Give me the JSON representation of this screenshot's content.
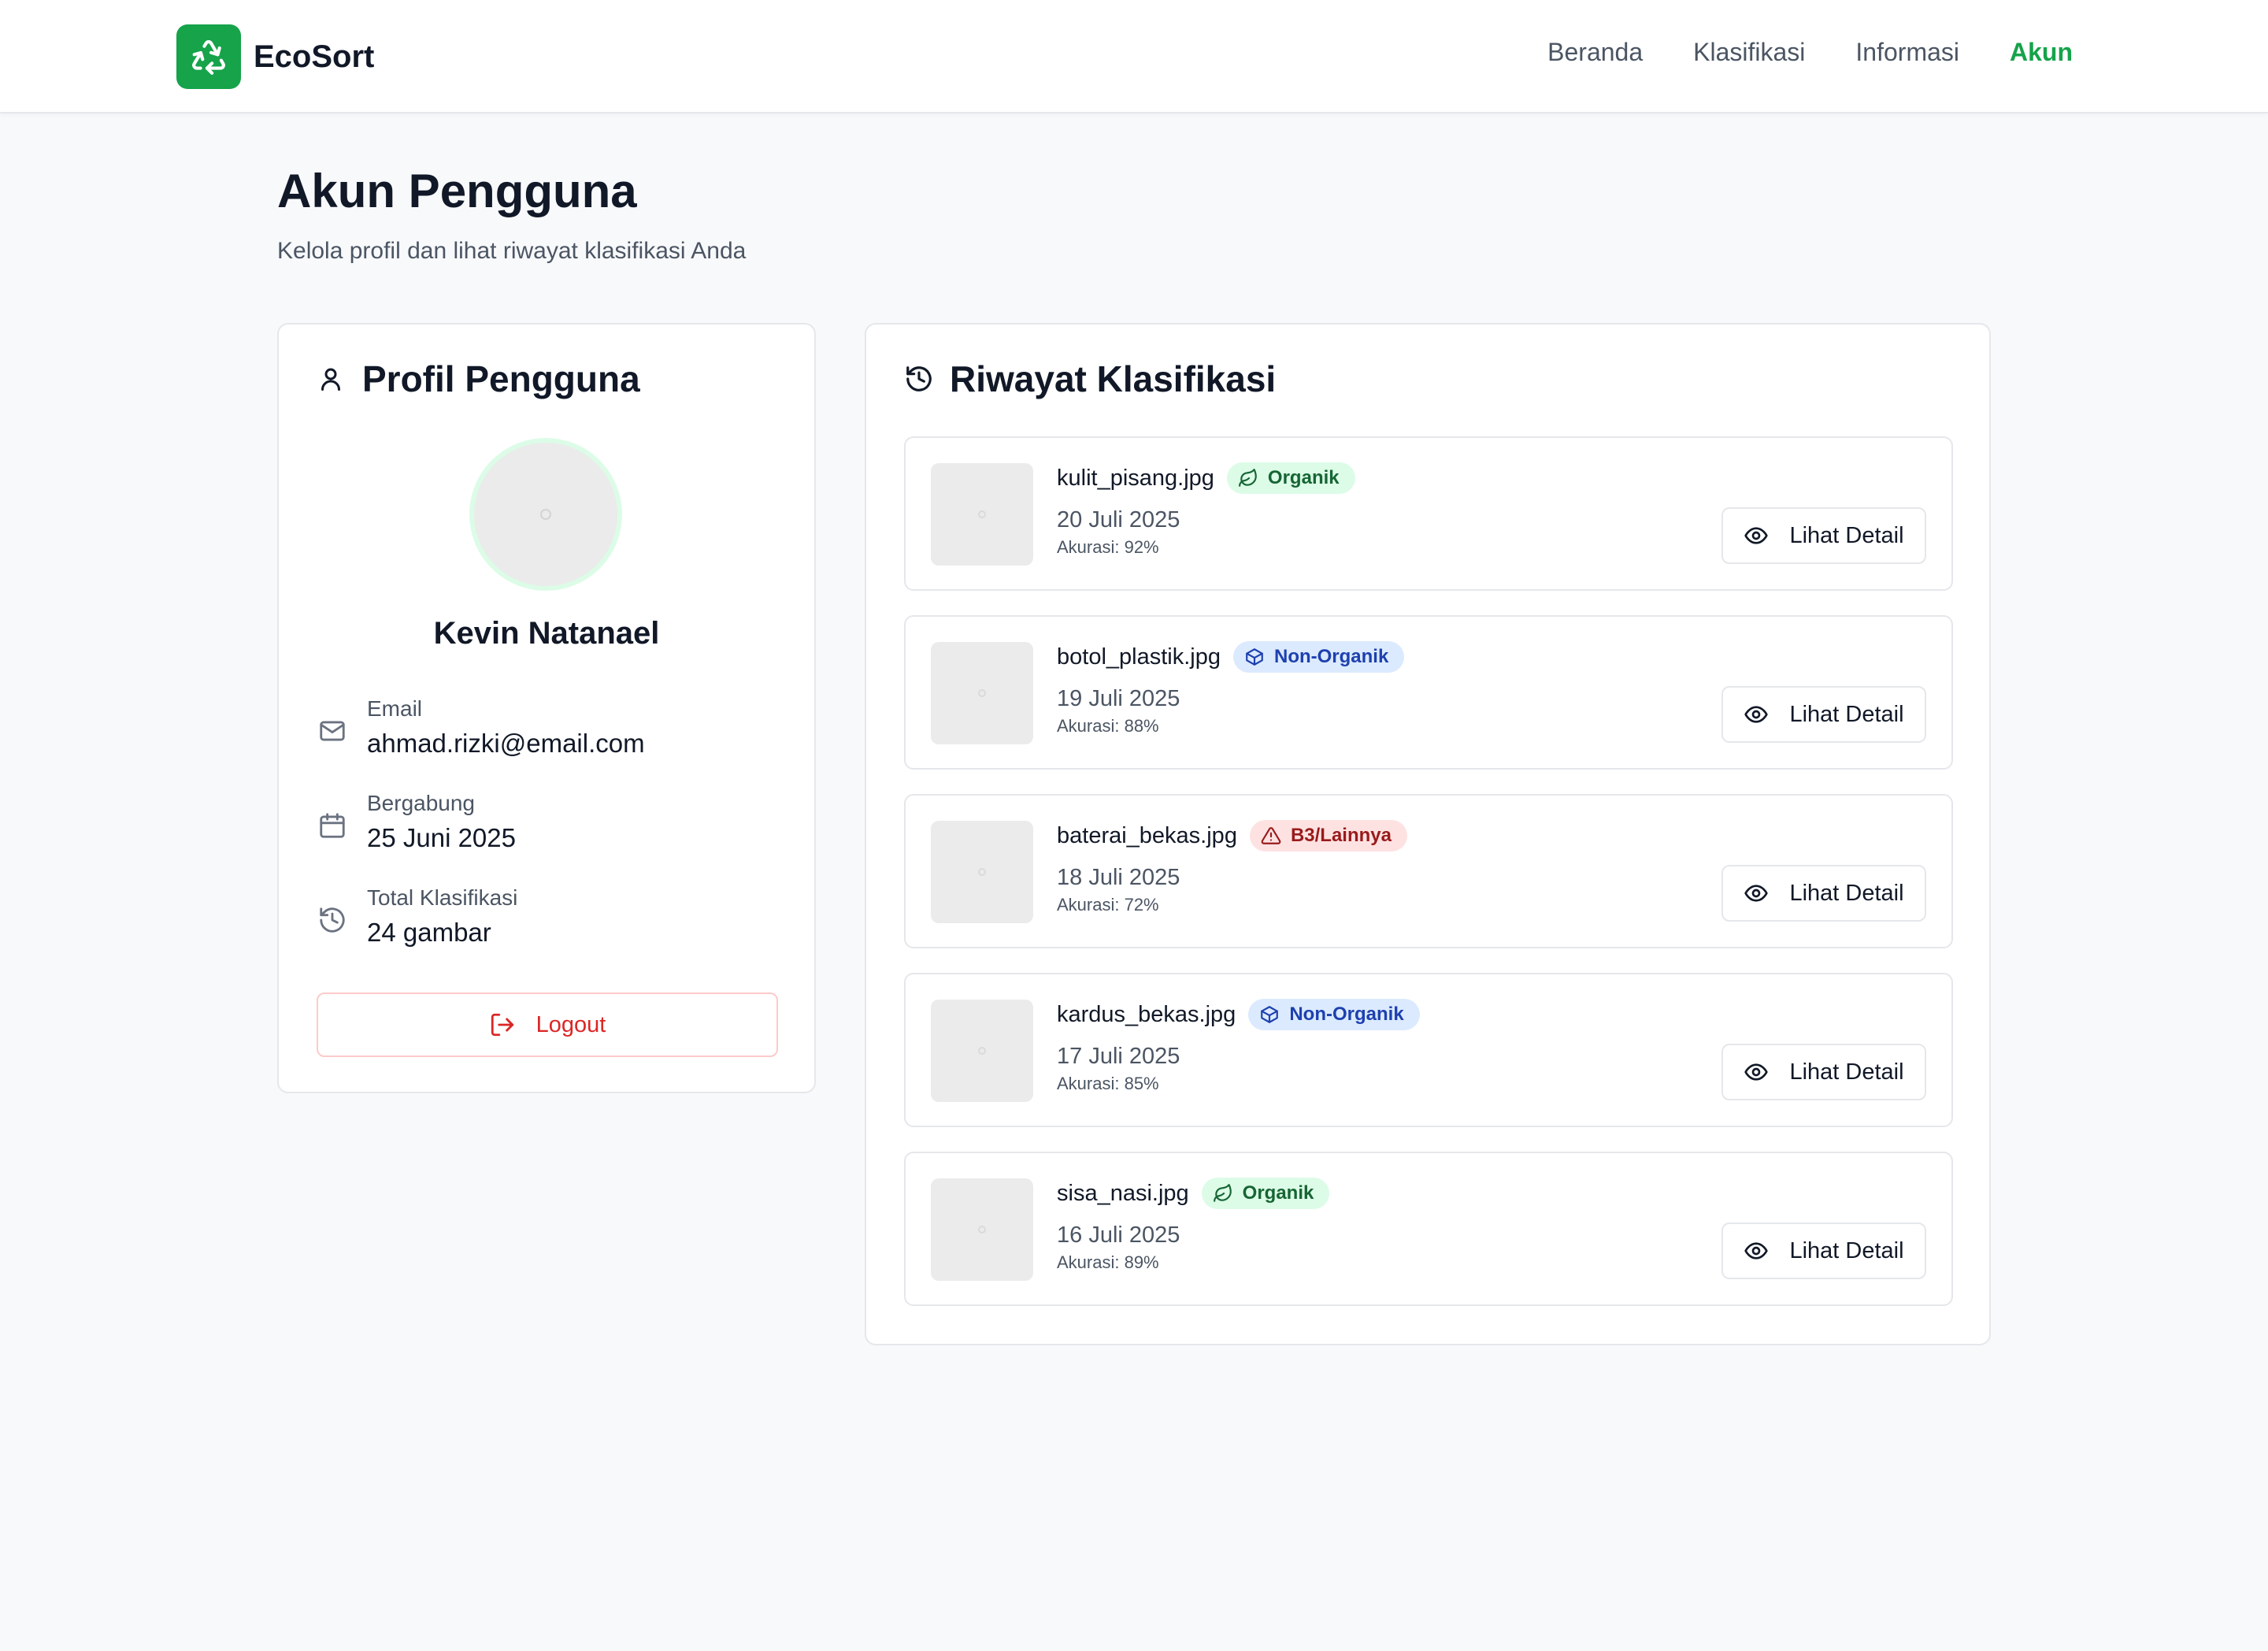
{
  "app": {
    "name": "EcoSort",
    "logo_icon": "recycle-icon",
    "accent": "#16a34a"
  },
  "nav": {
    "items": [
      {
        "label": "Beranda",
        "active": false
      },
      {
        "label": "Klasifikasi",
        "active": false
      },
      {
        "label": "Informasi",
        "active": false
      },
      {
        "label": "Akun",
        "active": true
      }
    ]
  },
  "page": {
    "title": "Akun Pengguna",
    "subtitle": "Kelola profil dan lihat riwayat klasifikasi Anda"
  },
  "profile": {
    "title": "Profil Pengguna",
    "title_icon": "user-icon",
    "name": "Kevin Natanael",
    "email_label": "Email",
    "email": "ahmad.rizki@email.com",
    "joined_label": "Bergabung",
    "joined": "25 Juni 2025",
    "total_label": "Total Klasifikasi",
    "total": "24 gambar",
    "logout_label": "Logout"
  },
  "history": {
    "title": "Riwayat Klasifikasi",
    "title_icon": "history-icon",
    "detail_label": "Lihat Detail",
    "items": [
      {
        "filename": "kulit_pisang.jpg",
        "category": "Organik",
        "type": "organik",
        "icon": "leaf-icon",
        "date": "20 Juli 2025",
        "accuracy": "Akurasi: 92%"
      },
      {
        "filename": "botol_plastik.jpg",
        "category": "Non-Organik",
        "type": "nonorganik",
        "icon": "box-icon",
        "date": "19 Juli 2025",
        "accuracy": "Akurasi: 88%"
      },
      {
        "filename": "baterai_bekas.jpg",
        "category": "B3/Lainnya",
        "type": "b3",
        "icon": "warning-icon",
        "date": "18 Juli 2025",
        "accuracy": "Akurasi: 72%"
      },
      {
        "filename": "kardus_bekas.jpg",
        "category": "Non-Organik",
        "type": "nonorganik",
        "icon": "box-icon",
        "date": "17 Juli 2025",
        "accuracy": "Akurasi: 85%"
      },
      {
        "filename": "sisa_nasi.jpg",
        "category": "Organik",
        "type": "organik",
        "icon": "leaf-icon",
        "date": "16 Juli 2025",
        "accuracy": "Akurasi: 89%"
      }
    ]
  }
}
